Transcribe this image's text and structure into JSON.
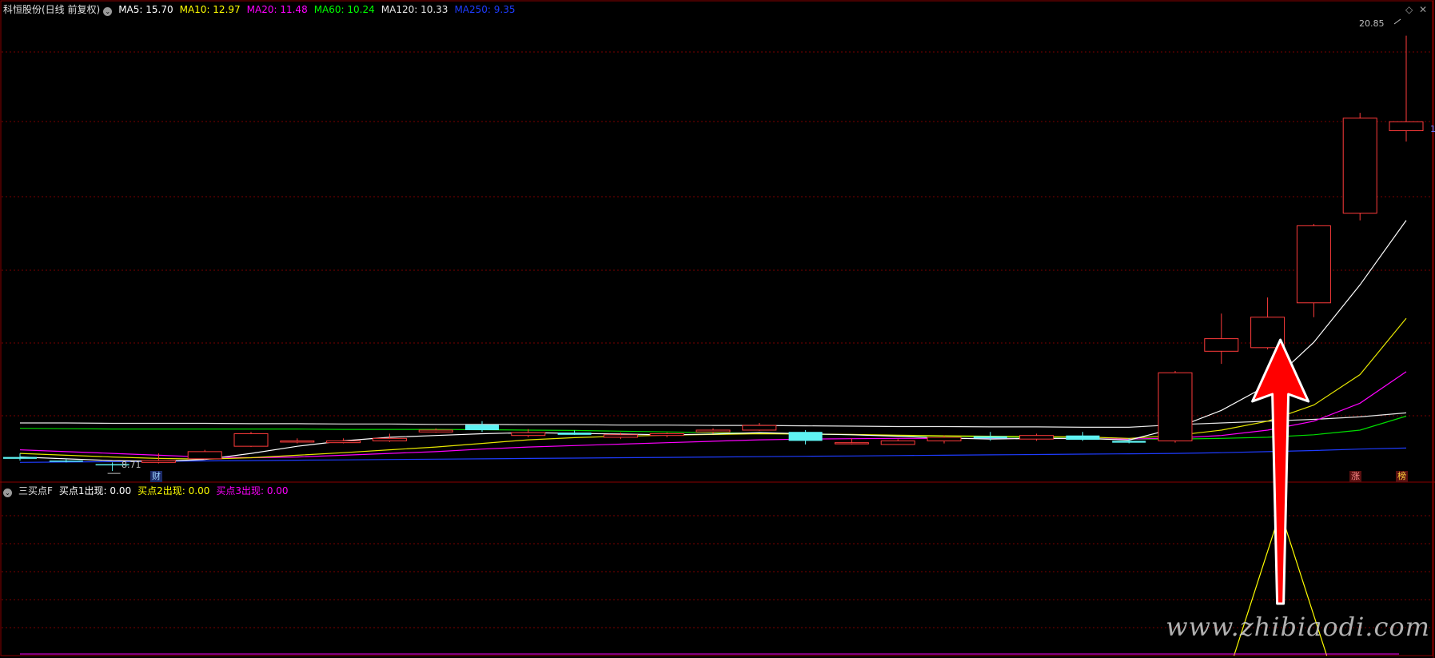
{
  "header": {
    "stock_title": "科恒股份(日线 前复权)",
    "ma": [
      {
        "label": "MA5: 15.70",
        "color": "#ffffff"
      },
      {
        "label": "MA10: 12.97",
        "color": "#ffff00"
      },
      {
        "label": "MA20: 11.48",
        "color": "#ff00ff"
      },
      {
        "label": "MA60: 10.24",
        "color": "#00ff00"
      },
      {
        "label": "MA120: 10.33",
        "color": "#e6e6e6"
      },
      {
        "label": "MA250: 9.35",
        "color": "#0033ff"
      }
    ]
  },
  "indicator": {
    "name": "三买点F",
    "items": [
      {
        "label": "买点1出现: 0.00",
        "color": "#ffffff"
      },
      {
        "label": "买点2出现: 0.00",
        "color": "#ffff00"
      },
      {
        "label": "买点3出现: 0.00",
        "color": "#ff00ff"
      }
    ]
  },
  "annotations": {
    "high_price": "20.85",
    "low_price": "8.71",
    "axis_mark": "1",
    "cai_tag": "财",
    "zhang_tag": "涨",
    "bang_tag": "榜"
  },
  "watermark": "www.zhibiaodi.com",
  "colors": {
    "up": "#ff3b3b",
    "down": "#5ff3f3",
    "grid": "#7a0000",
    "arrow": "#ff0000"
  },
  "chart_data": {
    "type": "candlestick",
    "candles": [
      {
        "o": 9.1,
        "h": 9.2,
        "l": 9.0,
        "c": 9.05
      },
      {
        "o": 9.0,
        "h": 9.05,
        "l": 8.95,
        "c": 8.98
      },
      {
        "o": 8.9,
        "h": 8.95,
        "l": 8.71,
        "c": 8.88
      },
      {
        "o": 8.95,
        "h": 9.2,
        "l": 8.92,
        "c": 9.0
      },
      {
        "o": 9.05,
        "h": 9.3,
        "l": 9.03,
        "c": 9.25
      },
      {
        "o": 9.4,
        "h": 9.8,
        "l": 9.38,
        "c": 9.75
      },
      {
        "o": 9.52,
        "h": 9.62,
        "l": 9.48,
        "c": 9.55
      },
      {
        "o": 9.5,
        "h": 9.62,
        "l": 9.48,
        "c": 9.55
      },
      {
        "o": 9.55,
        "h": 9.75,
        "l": 9.52,
        "c": 9.62
      },
      {
        "o": 9.8,
        "h": 9.9,
        "l": 9.78,
        "c": 9.85
      },
      {
        "o": 10.0,
        "h": 10.1,
        "l": 9.8,
        "c": 9.85
      },
      {
        "o": 9.7,
        "h": 9.88,
        "l": 9.65,
        "c": 9.78
      },
      {
        "o": 9.78,
        "h": 9.84,
        "l": 9.72,
        "c": 9.72
      },
      {
        "o": 9.65,
        "h": 9.78,
        "l": 9.6,
        "c": 9.72
      },
      {
        "o": 9.7,
        "h": 9.78,
        "l": 9.65,
        "c": 9.75
      },
      {
        "o": 9.8,
        "h": 9.9,
        "l": 9.75,
        "c": 9.85
      },
      {
        "o": 9.85,
        "h": 10.05,
        "l": 9.83,
        "c": 9.98
      },
      {
        "o": 9.8,
        "h": 9.85,
        "l": 9.45,
        "c": 9.55
      },
      {
        "o": 9.5,
        "h": 9.62,
        "l": 9.45,
        "c": 9.5
      },
      {
        "o": 9.45,
        "h": 9.6,
        "l": 9.45,
        "c": 9.55
      },
      {
        "o": 9.55,
        "h": 9.7,
        "l": 9.48,
        "c": 9.65
      },
      {
        "o": 9.68,
        "h": 9.8,
        "l": 9.55,
        "c": 9.62
      },
      {
        "o": 9.6,
        "h": 9.75,
        "l": 9.55,
        "c": 9.7
      },
      {
        "o": 9.7,
        "h": 9.8,
        "l": 9.55,
        "c": 9.58
      },
      {
        "o": 9.55,
        "h": 9.62,
        "l": 9.48,
        "c": 9.5
      },
      {
        "o": 9.55,
        "h": 11.5,
        "l": 9.5,
        "c": 11.45
      },
      {
        "o": 12.05,
        "h": 13.1,
        "l": 11.7,
        "c": 12.4
      },
      {
        "o": 12.15,
        "h": 13.55,
        "l": 12.1,
        "c": 13.0
      },
      {
        "o": 13.4,
        "h": 15.6,
        "l": 13.0,
        "c": 15.55
      },
      {
        "o": 15.9,
        "h": 18.7,
        "l": 15.7,
        "c": 18.55
      },
      {
        "o": 18.2,
        "h": 20.85,
        "l": 17.9,
        "c": 18.45
      }
    ],
    "ma5": [
      9.1,
      9.05,
      9.0,
      8.98,
      9.03,
      9.2,
      9.4,
      9.55,
      9.65,
      9.7,
      9.75,
      9.78,
      9.76,
      9.74,
      9.72,
      9.74,
      9.78,
      9.75,
      9.72,
      9.68,
      9.63,
      9.6,
      9.62,
      9.62,
      9.57,
      9.9,
      10.4,
      11.1,
      12.3,
      13.9,
      15.7
    ],
    "ma10": [
      9.2,
      9.15,
      9.1,
      9.06,
      9.04,
      9.08,
      9.15,
      9.22,
      9.3,
      9.38,
      9.48,
      9.58,
      9.64,
      9.68,
      9.71,
      9.73,
      9.75,
      9.74,
      9.73,
      9.71,
      9.69,
      9.68,
      9.67,
      9.66,
      9.62,
      9.7,
      9.85,
      10.1,
      10.55,
      11.4,
      12.97
    ],
    "ma20": [
      9.3,
      9.25,
      9.2,
      9.15,
      9.1,
      9.08,
      9.1,
      9.15,
      9.2,
      9.25,
      9.32,
      9.38,
      9.42,
      9.46,
      9.5,
      9.54,
      9.58,
      9.6,
      9.61,
      9.62,
      9.62,
      9.62,
      9.62,
      9.61,
      9.6,
      9.63,
      9.7,
      9.85,
      10.1,
      10.6,
      11.48
    ],
    "ma60": [
      9.9,
      9.89,
      9.88,
      9.88,
      9.88,
      9.88,
      9.88,
      9.87,
      9.87,
      9.87,
      9.86,
      9.85,
      9.84,
      9.82,
      9.8,
      9.78,
      9.76,
      9.74,
      9.72,
      9.7,
      9.68,
      9.66,
      9.64,
      9.62,
      9.6,
      9.6,
      9.62,
      9.65,
      9.72,
      9.85,
      10.24
    ],
    "ma120": [
      10.05,
      10.05,
      10.04,
      10.04,
      10.04,
      10.03,
      10.03,
      10.02,
      10.02,
      10.01,
      10.01,
      10.0,
      10.0,
      9.99,
      9.99,
      9.98,
      9.98,
      9.97,
      9.96,
      9.95,
      9.95,
      9.94,
      9.94,
      9.93,
      9.93,
      10.0,
      10.05,
      10.1,
      10.15,
      10.22,
      10.33
    ],
    "ma250": [
      8.95,
      8.96,
      8.97,
      8.98,
      8.99,
      9.0,
      9.01,
      9.02,
      9.03,
      9.04,
      9.05,
      9.06,
      9.07,
      9.08,
      9.09,
      9.1,
      9.11,
      9.12,
      9.13,
      9.14,
      9.15,
      9.16,
      9.17,
      9.18,
      9.19,
      9.2,
      9.22,
      9.25,
      9.28,
      9.32,
      9.35
    ],
    "price_range": [
      8.4,
      21.4
    ],
    "signal": {
      "name": "买点2出现",
      "peak_index": 27,
      "values": [
        0,
        0,
        0,
        0,
        0,
        0,
        0,
        0,
        0,
        0,
        0,
        0,
        0,
        0,
        0,
        0,
        0,
        0,
        0,
        0,
        0,
        0,
        0,
        0,
        0,
        0,
        0,
        1,
        0,
        0,
        0
      ]
    }
  }
}
